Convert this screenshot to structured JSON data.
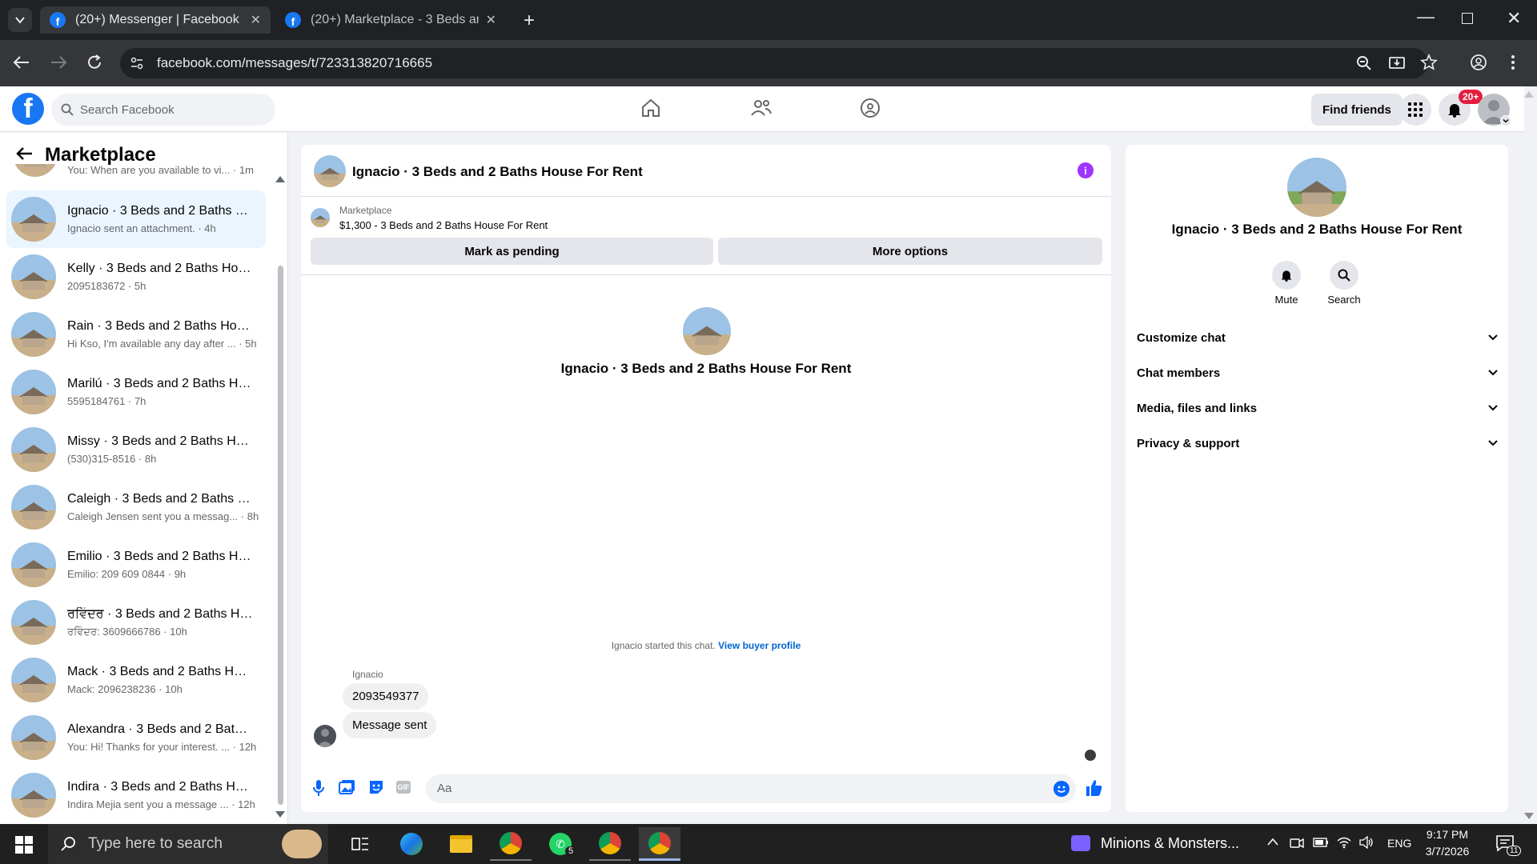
{
  "browser": {
    "tabs": [
      {
        "title": "(20+) Messenger | Facebook",
        "active": true
      },
      {
        "title": "(20+) Marketplace - 3 Beds and",
        "active": false
      }
    ],
    "url": "facebook.com/messages/t/723313820716665"
  },
  "fb_header": {
    "search_placeholder": "Search Facebook",
    "find_friends": "Find friends",
    "notification_badge": "20+"
  },
  "sidebar": {
    "title": "Marketplace",
    "partial_top": "You: When are you available to vi... · 1m",
    "conversations": [
      {
        "title": "Ignacio · 3 Beds and 2 Baths Ho...",
        "sub": "Ignacio sent an attachment. · 4h",
        "active": true
      },
      {
        "title": "Kelly · 3 Beds and 2 Baths Hous...",
        "sub": "2095183672 · 5h",
        "active": false
      },
      {
        "title": "Rain · 3 Beds and 2 Baths Hous...",
        "sub": "Hi Kso, I'm available any day after ... · 5h",
        "active": false
      },
      {
        "title": "Marilú · 3 Beds and 2 Baths Ho...",
        "sub": "5595184761 · 7h",
        "active": false
      },
      {
        "title": "Missy · 3 Beds and 2 Baths Hou...",
        "sub": "(530)315-8516 · 8h",
        "active": false
      },
      {
        "title": "Caleigh · 3 Beds and 2 Baths Ho...",
        "sub": "Caleigh Jensen sent you a messag... · 8h",
        "active": false
      },
      {
        "title": "Emilio · 3 Beds and 2 Baths Hou...",
        "sub": "Emilio: 209 609 0844 · 9h",
        "active": false
      },
      {
        "title": "ਰਵਿੰਦਰ · 3 Beds and 2 Baths Hou...",
        "sub": "ਰਵਿੰਦਰ: 3609666786 · 10h",
        "active": false
      },
      {
        "title": "Mack · 3 Beds and 2 Baths Hous...",
        "sub": "Mack: 2096238236 · 10h",
        "active": false
      },
      {
        "title": "Alexandra · 3 Beds and 2 Baths ...",
        "sub": "You: Hi! Thanks for your interest. ... · 12h",
        "active": false
      },
      {
        "title": "Indira · 3 Beds and 2 Baths Hou...",
        "sub": "Indira Mejia sent you a message ... · 12h",
        "active": false
      }
    ]
  },
  "chat": {
    "title": "Ignacio · 3 Beds and 2 Baths House For Rent",
    "marketplace_label": "Marketplace",
    "listing": "$1,300 - 3 Beds and 2 Baths House For Rent",
    "mark_pending": "Mark as pending",
    "more_options": "More options",
    "center_name": "Ignacio · 3 Beds and 2 Baths House For Rent",
    "started_text": "Ignacio started this chat.",
    "view_buyer": "View buyer profile",
    "sender": "Ignacio",
    "messages": [
      "2093549377",
      "Message sent"
    ],
    "composer_placeholder": "Aa"
  },
  "right_panel": {
    "name": "Ignacio · 3 Beds and 2 Baths House For Rent",
    "mute": "Mute",
    "search": "Search",
    "sections": [
      "Customize chat",
      "Chat members",
      "Media, files and links",
      "Privacy & support"
    ]
  },
  "taskbar": {
    "search_placeholder": "Type here to search",
    "media": "Minions & Monsters...",
    "lang": "ENG",
    "time": "9:17 PM",
    "date": "3/7/2026",
    "notification_count": "11",
    "whatsapp_badge": "5"
  },
  "colors": {
    "fb_blue": "#1877f2",
    "active_conv": "#ebf5ff",
    "info_purple": "#a033ff",
    "link_blue": "#0064d1"
  }
}
